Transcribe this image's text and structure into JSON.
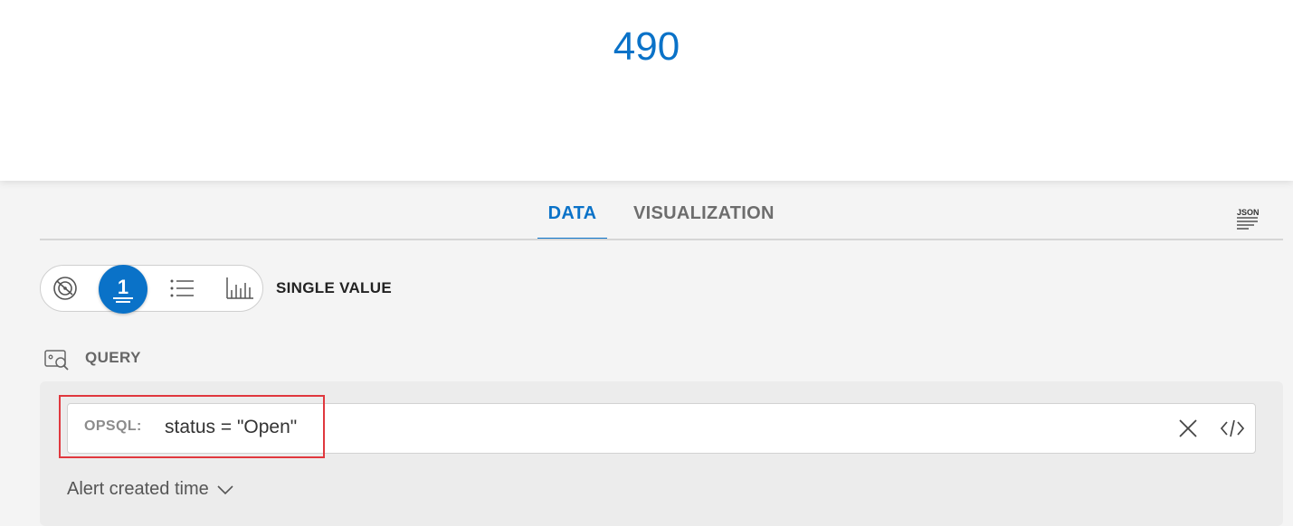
{
  "preview": {
    "value": "490"
  },
  "tabs": [
    {
      "label": "DATA",
      "active": true
    },
    {
      "label": "VISUALIZATION",
      "active": false
    }
  ],
  "json_button": {
    "label": "JSON"
  },
  "visualization": {
    "options": [
      {
        "icon": "radar-chart-icon"
      },
      {
        "icon": "single-value-icon",
        "glyph": "1",
        "active": true
      },
      {
        "icon": "list-icon"
      },
      {
        "icon": "bar-chart-icon"
      }
    ],
    "selected_label": "SINGLE VALUE"
  },
  "query": {
    "section_label": "QUERY",
    "opsql_label": "OPSQL:",
    "opsql_value": "status = \"Open\"",
    "time_field": "Alert created time"
  },
  "colors": {
    "accent": "#0a72c8",
    "highlight": "#e0383e"
  }
}
